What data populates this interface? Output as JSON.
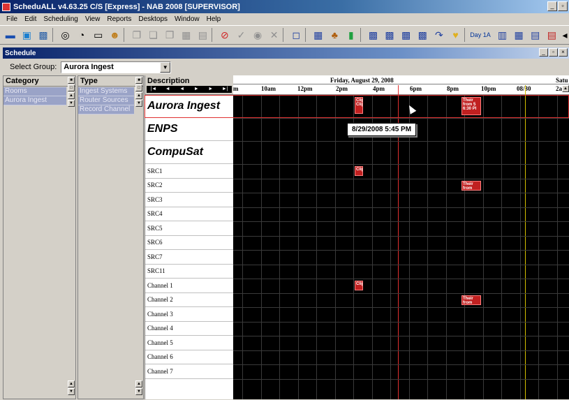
{
  "window": {
    "title": "ScheduALL v4.63.25 C/S [Express] - NAB 2008 [SUPERVISOR]"
  },
  "menu": [
    "File",
    "Edit",
    "Scheduling",
    "View",
    "Reports",
    "Desktops",
    "Window",
    "Help"
  ],
  "toolbar": {
    "icons": [
      "folder-icon",
      "monitor-icon",
      "save-icon",
      "stopwatch-icon",
      "clock-icon",
      "calendar-icon",
      "user-icon",
      "copy-icon",
      "paste-icon",
      "cut-icon",
      "grid-icon",
      "list-icon",
      "stop-icon",
      "check-icon",
      "circle-check-icon",
      "cancel-icon",
      "window-icon",
      "calc-icon",
      "people-icon",
      "chart-icon",
      "schedule-a-icon",
      "schedule-b-icon",
      "schedule-c-icon",
      "schedule-d-icon",
      "route-icon",
      "heart-icon"
    ],
    "day_label": "Day 1A"
  },
  "schedule_window": {
    "title": "Schedule"
  },
  "select_group": {
    "label": "Select Group:",
    "value": "Aurora Ingest"
  },
  "panels": {
    "category": {
      "header": "Category",
      "items": [
        "Rooms",
        "Aurora Ingest"
      ]
    },
    "type": {
      "header": "Type",
      "items": [
        "Ingest Systems",
        "Router Sources",
        "Record Channel"
      ]
    }
  },
  "grid": {
    "description_header": "Description",
    "nav_buttons": [
      "|◄",
      "◄",
      "◄",
      "►",
      "►",
      "►|"
    ],
    "date_main": "Friday, August 29, 2008",
    "date_next": "Satu",
    "hours": [
      "m",
      "10am",
      "12pm",
      "2pm",
      "4pm",
      "6pm",
      "8pm",
      "10pm",
      "08/30",
      "2a"
    ],
    "rows": [
      {
        "label": "Aurora Ingest",
        "size": "big"
      },
      {
        "label": "ENPS",
        "size": "big"
      },
      {
        "label": "CompuSat",
        "size": "big"
      },
      {
        "label": "SRC1",
        "size": "small"
      },
      {
        "label": "SRC2",
        "size": "small"
      },
      {
        "label": "SRC3",
        "size": "small"
      },
      {
        "label": "SRC4",
        "size": "small"
      },
      {
        "label": "SRC5",
        "size": "small"
      },
      {
        "label": "SRC6",
        "size": "small"
      },
      {
        "label": "SRC7",
        "size": "small"
      },
      {
        "label": "SRC11",
        "size": "small"
      },
      {
        "label": "Channel 1",
        "size": "small"
      },
      {
        "label": "Channel 2",
        "size": "small"
      },
      {
        "label": "Channel 3",
        "size": "small"
      },
      {
        "label": "Channel 4",
        "size": "small"
      },
      {
        "label": "Channel 5",
        "size": "small"
      },
      {
        "label": "Channel 6",
        "size": "small"
      },
      {
        "label": "Channel 7",
        "size": "small"
      }
    ],
    "events": [
      {
        "row": 0,
        "text": "Clip Clip"
      },
      {
        "row": 0,
        "text": "Their from 5 6:30 PI"
      },
      {
        "row": 3,
        "text": "Clip"
      },
      {
        "row": 4,
        "text": "Their from"
      },
      {
        "row": 11,
        "text": "Clip"
      },
      {
        "row": 12,
        "text": "Their from"
      }
    ],
    "tooltip": "8/29/2008 5:45 PM"
  }
}
